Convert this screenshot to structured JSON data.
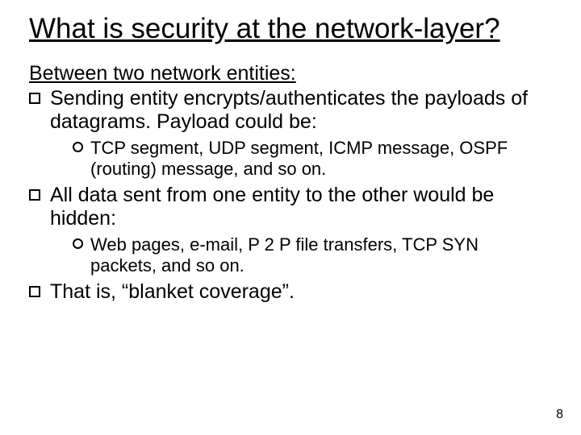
{
  "title": "What is security at the network-layer?",
  "subheading": "Between two network entities:",
  "bullets": [
    {
      "text": "Sending entity encrypts/authenticates the payloads of datagrams. Payload could be:",
      "sub": [
        "TCP segment, UDP segment, ICMP message, OSPF (routing) message, and so on."
      ]
    },
    {
      "text": "All data sent from one entity to the other would be hidden:",
      "sub": [
        "Web pages, e-mail, P 2 P file transfers, TCP SYN packets, and so on."
      ]
    },
    {
      "text": "That is, “blanket coverage”."
    }
  ],
  "pageNumber": "8"
}
